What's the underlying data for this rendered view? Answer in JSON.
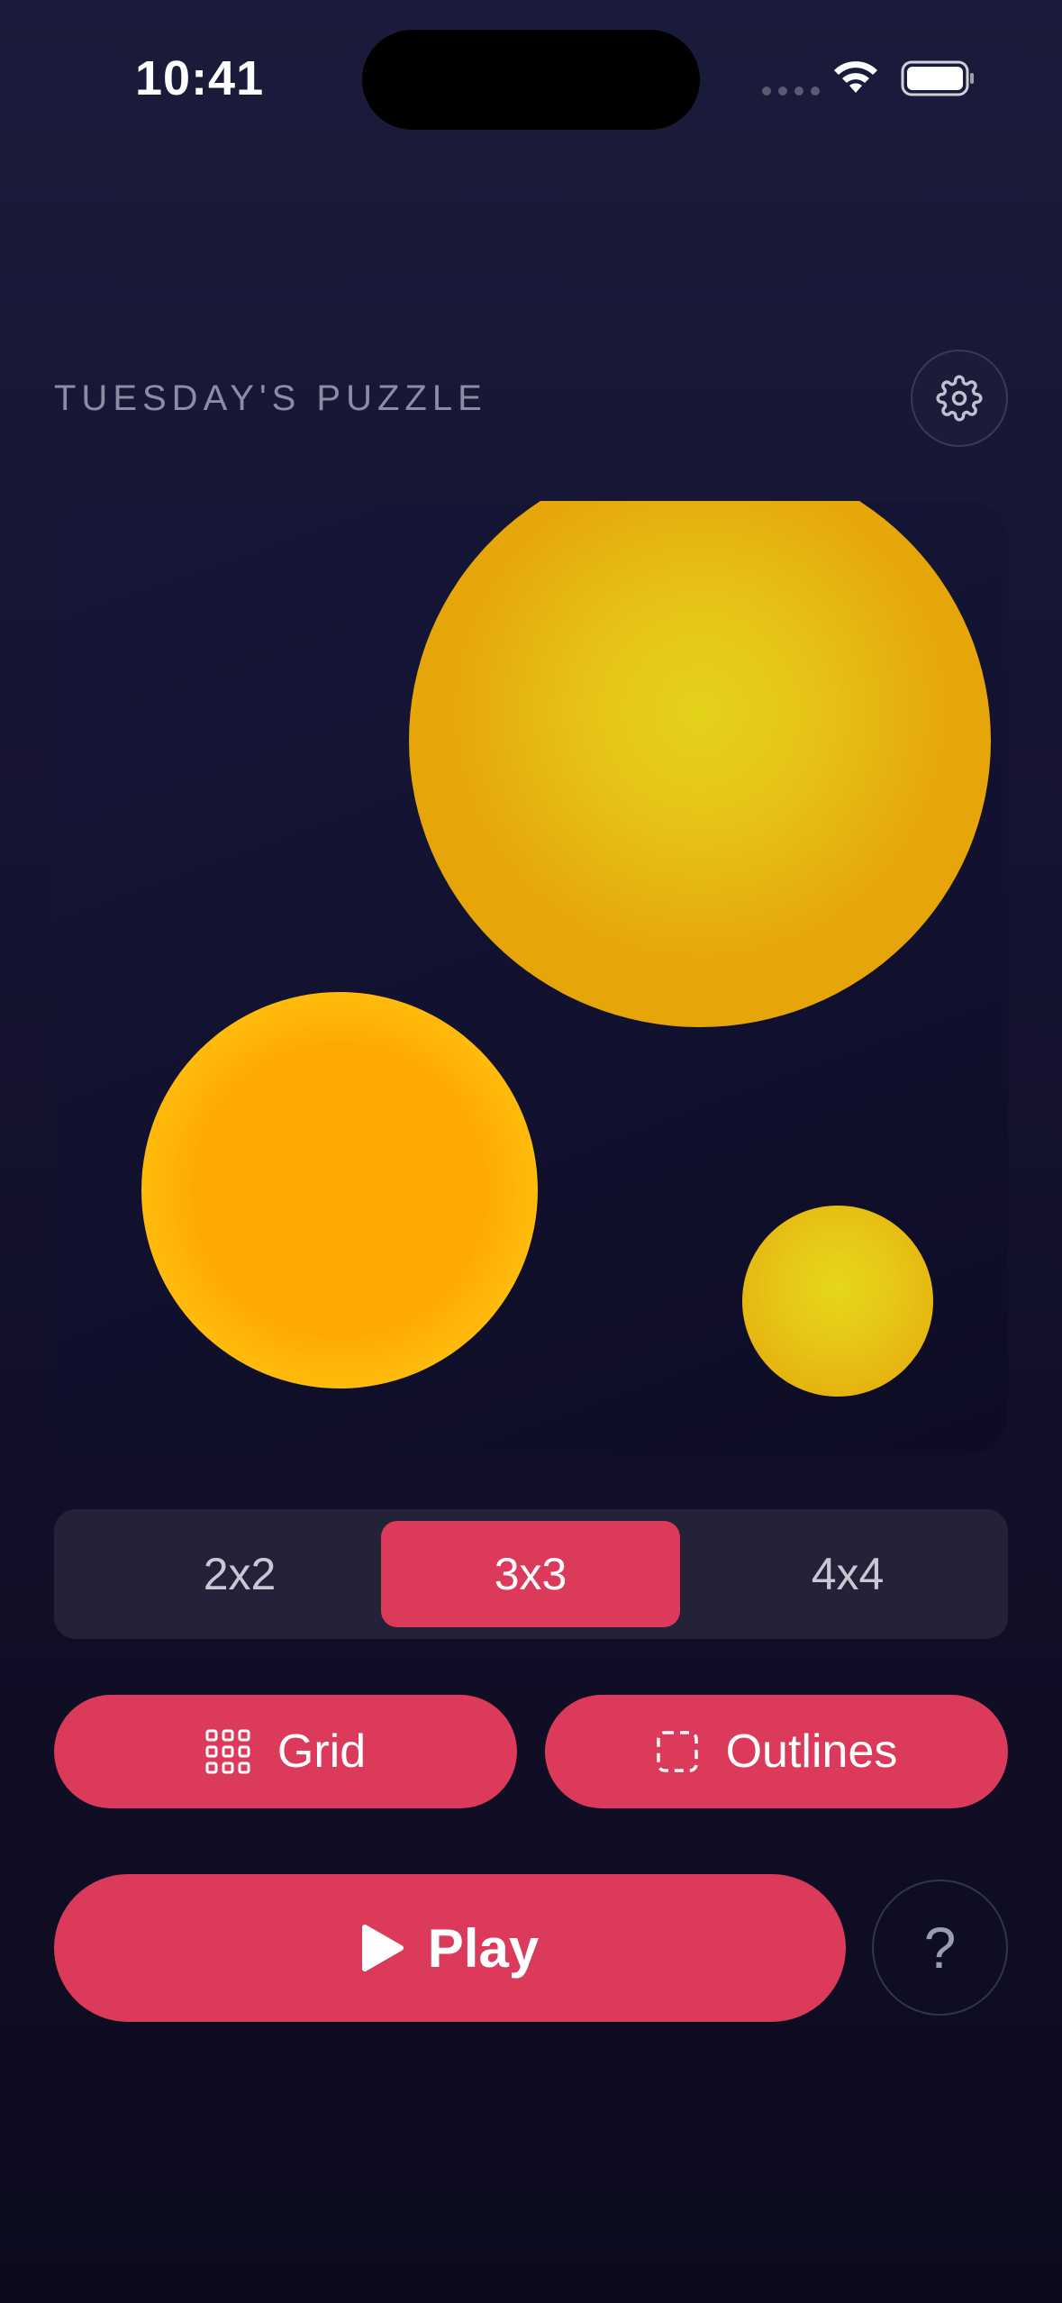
{
  "status_bar": {
    "time": "10:41",
    "icons": [
      "cellular-signal-icon",
      "wifi-icon",
      "battery-icon"
    ]
  },
  "header": {
    "title": "TUESDAY'S PUZZLE",
    "settings_icon": "gear-icon"
  },
  "puzzle": {
    "shapes": [
      {
        "name": "large-circle",
        "colors": [
          "#e4d21a",
          "#e6a408"
        ]
      },
      {
        "name": "medium-circle",
        "colors": [
          "#ffa703",
          "#fed712"
        ]
      },
      {
        "name": "small-circle",
        "colors": [
          "#e6d61c",
          "#e6a60a"
        ]
      }
    ]
  },
  "size_selector": {
    "options": [
      "2x2",
      "3x3",
      "4x4"
    ],
    "selected": "3x3"
  },
  "toggles": {
    "grid_label": "Grid",
    "grid_icon": "grid-icon",
    "outlines_label": "Outlines",
    "outlines_icon": "dashed-square-icon"
  },
  "actions": {
    "play_label": "Play",
    "play_icon": "play-icon",
    "help_label": "?"
  },
  "colors": {
    "accent": "#dc3a5a",
    "background_top": "#1b1b3b",
    "background_bottom": "#0c0b1e",
    "muted_text": "#8c8ca3"
  }
}
